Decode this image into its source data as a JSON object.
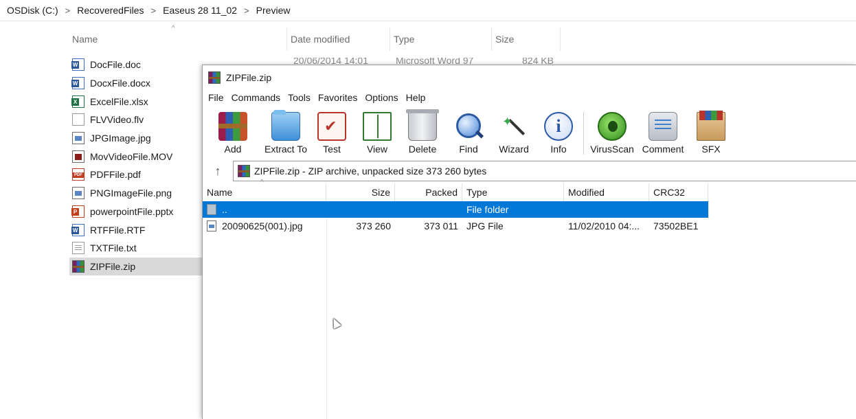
{
  "breadcrumb": {
    "items": [
      "OSDisk (C:)",
      "RecoveredFiles",
      "Easeus 28 11_02",
      "Preview"
    ]
  },
  "explorer": {
    "columns": {
      "name": "Name",
      "date_modified": "Date modified",
      "type": "Type",
      "size": "Size"
    },
    "files": [
      {
        "name": "DocFile.doc",
        "icon": "word-doc-icon"
      },
      {
        "name": "DocxFile.docx",
        "icon": "word-doc-icon"
      },
      {
        "name": "ExcelFile.xlsx",
        "icon": "excel-icon"
      },
      {
        "name": "FLVVideo.flv",
        "icon": "blank-file-icon"
      },
      {
        "name": "JPGImage.jpg",
        "icon": "image-file-icon"
      },
      {
        "name": "MovVideoFile.MOV",
        "icon": "video-file-icon"
      },
      {
        "name": "PDFFile.pdf",
        "icon": "pdf-icon"
      },
      {
        "name": "PNGImageFile.png",
        "icon": "image-file-icon"
      },
      {
        "name": "powerpointFile.pptx",
        "icon": "powerpoint-icon"
      },
      {
        "name": "RTFFile.RTF",
        "icon": "word-doc-icon"
      },
      {
        "name": "TXTFile.txt",
        "icon": "text-file-icon"
      },
      {
        "name": "ZIPFile.zip",
        "icon": "winrar-archive-icon",
        "selected": true
      }
    ],
    "partial_row": {
      "date": "20/06/2014 14:01",
      "type": "Microsoft Word 97",
      "size": "824 KB"
    }
  },
  "winrar": {
    "title": "ZIPFile.zip",
    "menu": [
      "File",
      "Commands",
      "Tools",
      "Favorites",
      "Options",
      "Help"
    ],
    "toolbar": [
      {
        "label": "Add",
        "icon": "add-archive-icon"
      },
      {
        "label": "Extract To",
        "icon": "extract-folder-icon"
      },
      {
        "label": "Test",
        "icon": "test-clipboard-icon"
      },
      {
        "label": "View",
        "icon": "view-book-icon"
      },
      {
        "label": "Delete",
        "icon": "trash-can-icon"
      },
      {
        "label": "Find",
        "icon": "magnifier-icon"
      },
      {
        "label": "Wizard",
        "icon": "magic-wand-icon"
      },
      {
        "label": "Info",
        "icon": "info-icon"
      },
      {
        "label": "VirusScan",
        "icon": "virus-scan-icon"
      },
      {
        "label": "Comment",
        "icon": "comment-icon"
      },
      {
        "label": "SFX",
        "icon": "sfx-box-icon"
      }
    ],
    "address": "ZIPFile.zip - ZIP archive, unpacked size 373 260 bytes",
    "up_arrow": "↑",
    "columns": {
      "name": "Name",
      "size": "Size",
      "packed": "Packed",
      "type": "Type",
      "modified": "Modified",
      "crc32": "CRC32"
    },
    "rows": [
      {
        "name": "..",
        "size": "",
        "packed": "",
        "type": "File folder",
        "modified": "",
        "crc32": "",
        "selected": true
      },
      {
        "name": "20090625(001).jpg",
        "size": "373 260",
        "packed": "373 011",
        "type": "JPG File",
        "modified": "11/02/2010 04:...",
        "crc32": "73502BE1",
        "selected": false
      }
    ]
  },
  "colors": {
    "selection_blue": "#0078d7",
    "explorer_selected": "#d9d9d9"
  }
}
